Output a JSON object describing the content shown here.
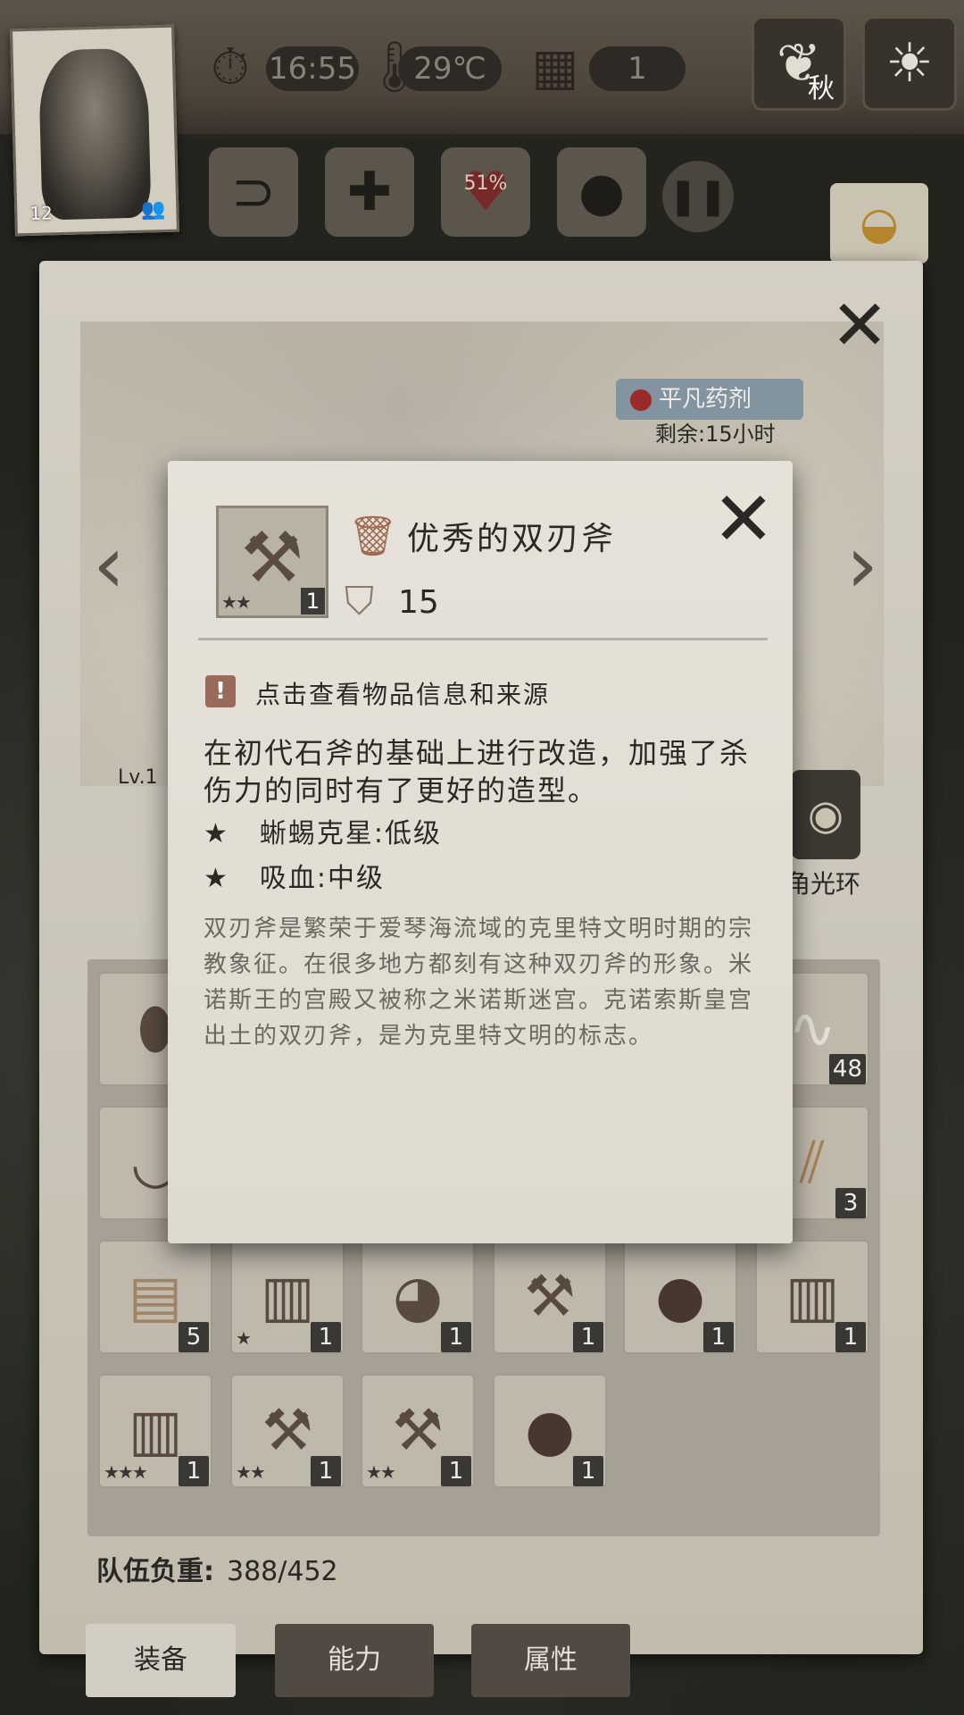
{
  "hud": {
    "time": "16:55",
    "temperature": "29℃",
    "day": "1",
    "season": "秋",
    "character_level": "12",
    "health_percent": "51%"
  },
  "background_panel": {
    "potion_name": "平凡药剂",
    "potion_remaining": "剩余:15小时",
    "level_label": "Lv.1",
    "aura_label": "角光环"
  },
  "inventory": {
    "slots": [
      {
        "icon": "ore-chunk-icon",
        "qty": ""
      },
      {
        "icon": "",
        "qty": ""
      },
      {
        "icon": "",
        "qty": ""
      },
      {
        "icon": "",
        "qty": ""
      },
      {
        "icon": "",
        "qty": ""
      },
      {
        "icon": "rope-icon",
        "qty": "48"
      },
      {
        "icon": "bowl-icon",
        "qty": ""
      },
      {
        "icon": "",
        "qty": ""
      },
      {
        "icon": "",
        "qty": ""
      },
      {
        "icon": "",
        "qty": ""
      },
      {
        "icon": "",
        "qty": ""
      },
      {
        "icon": "stick-bundle-icon",
        "qty": "3"
      },
      {
        "icon": "wood-planks-icon",
        "qty": "5",
        "stars": ""
      },
      {
        "icon": "leather-vest-icon",
        "qty": "1",
        "stars": "★"
      },
      {
        "icon": "round-shield-icon",
        "qty": "1",
        "stars": ""
      },
      {
        "icon": "double-axe-icon",
        "qty": "1",
        "stars": ""
      },
      {
        "icon": "wooden-shield-icon",
        "qty": "1",
        "stars": ""
      },
      {
        "icon": "leather-vest-icon",
        "qty": "1",
        "stars": ""
      },
      {
        "icon": "leather-vest-icon",
        "qty": "1",
        "stars": "★★★"
      },
      {
        "icon": "double-axe-icon",
        "qty": "1",
        "stars": "★★"
      },
      {
        "icon": "double-axe-icon",
        "qty": "1",
        "stars": "★★"
      },
      {
        "icon": "wooden-shield-icon",
        "qty": "1",
        "stars": ""
      }
    ],
    "weight_label": "队伍负重:",
    "weight_value": "388/452"
  },
  "tabs": [
    {
      "label": "装备"
    },
    {
      "label": "能力"
    },
    {
      "label": "属性"
    }
  ],
  "item_popup": {
    "name": "优秀的双刃斧",
    "quantity": "1",
    "stars": "★★",
    "weight": "15",
    "info_link": "点击查看物品信息和来源",
    "description": "在初代石斧的基础上进行改造，加强了杀伤力的同时有了更好的造型。",
    "traits": [
      {
        "text": "蜥蜴克星:低级"
      },
      {
        "text": "吸血:中级"
      }
    ],
    "lore": "双刃斧是繁荣于爱琴海流域的克里特文明时期的宗教象征。在很多地方都刻有这种双刃斧的形象。米诺斯王的宫殿又被称之米诺斯迷宫。克诺索斯皇宫出土的双刃斧，是为克里特文明的标志。"
  }
}
